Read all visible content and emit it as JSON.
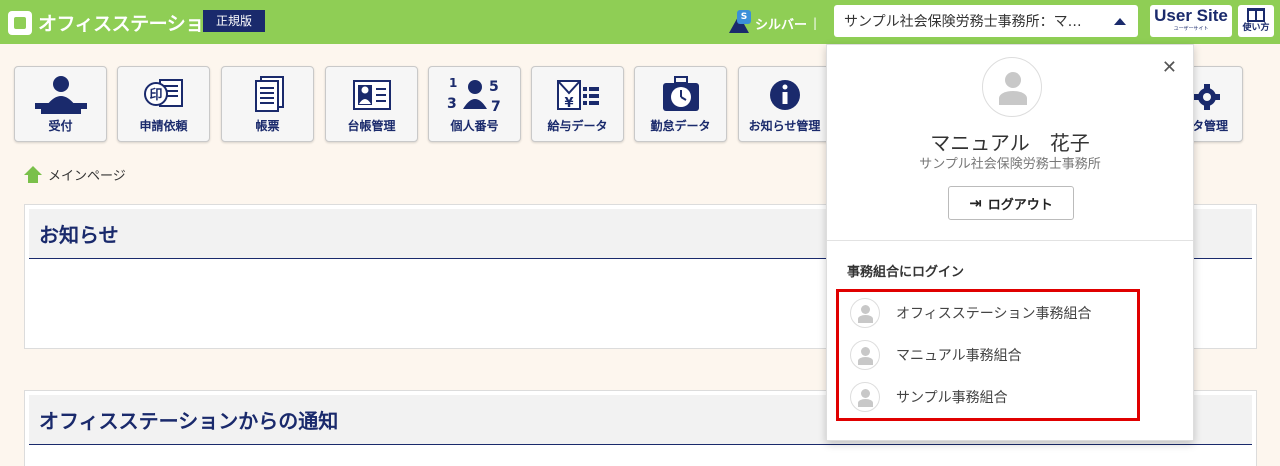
{
  "header": {
    "app_name": "オフィスステーション",
    "edition": "正規版",
    "plan": "シルバー",
    "plan_badge": "S",
    "office_selector": "サンプル社会保険労務士事務所：マ…",
    "user_site": "User Site",
    "user_site_sub": "ユーザーサイト",
    "help": "使い方"
  },
  "menu": [
    {
      "label": "受付",
      "icon": "reception-icon"
    },
    {
      "label": "申請依頼",
      "icon": "application-request-icon"
    },
    {
      "label": "帳票",
      "icon": "forms-icon"
    },
    {
      "label": "台帳管理",
      "icon": "ledger-icon"
    },
    {
      "label": "個人番号",
      "icon": "personal-number-icon"
    },
    {
      "label": "給与データ",
      "icon": "payroll-data-icon"
    },
    {
      "label": "勤怠データ",
      "icon": "attendance-data-icon"
    },
    {
      "label": "お知らせ管理",
      "icon": "info-icon"
    },
    {
      "label": "タ管理",
      "icon": "settings-icon"
    }
  ],
  "breadcrumb": "メインページ",
  "panels": {
    "notices": "お知らせ",
    "system_notices": "オフィスステーションからの通知"
  },
  "dropdown": {
    "user_name": "マニュアル　花子",
    "office_name": "サンプル社会保険労務士事務所",
    "logout": "ログアウト",
    "section_title": "事務組合にログイン",
    "associations": [
      "オフィスステーション事務組合",
      "マニュアル事務組合",
      "サンプル事務組合"
    ]
  },
  "colors": {
    "header_green": "#8fce55",
    "navy": "#1a2a6c",
    "highlight_red": "#e00000"
  }
}
